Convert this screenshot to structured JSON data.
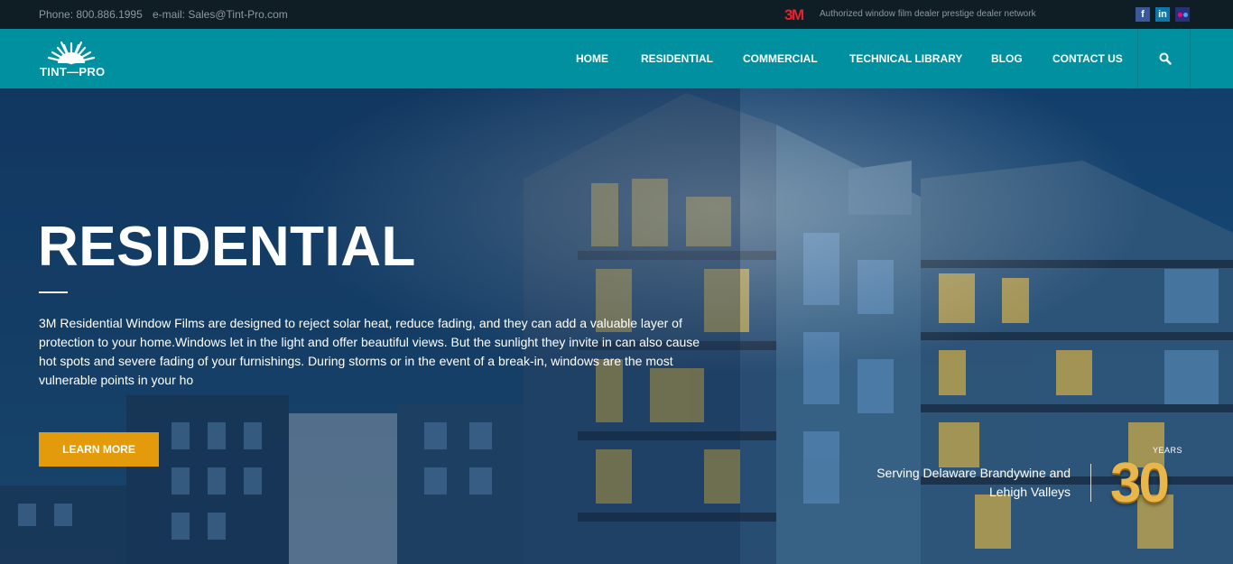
{
  "topbar": {
    "phone": "Phone: 800.886.1995",
    "email": "e-mail: Sales@Tint-Pro.com",
    "brand": "3M",
    "dealer_text": "Authorized window film dealer prestige dealer network",
    "social": [
      {
        "name": "facebook-icon",
        "glyph": "f"
      },
      {
        "name": "linkedin-icon",
        "glyph": "in"
      },
      {
        "name": "flickr-icon",
        "glyph": ""
      }
    ]
  },
  "nav": {
    "logo_text": "TINT—PRO",
    "items": [
      "HOME",
      "RESIDENTIAL",
      "COMMERCIAL",
      "TECHNICAL LIBRARY",
      "BLOG",
      "CONTACT US"
    ],
    "search_icon": "search-icon"
  },
  "hero": {
    "title": "RESIDENTIAL",
    "description": "3M Residential Window Films are designed to reject solar heat, reduce fading, and they can add a valuable layer of protection to your home.Windows let in the light and offer beautiful views. But the sunlight they invite in can also cause hot spots and severe fading of your furnishings. During storms or in the event of a break-in, windows are the most vulnerable points in your ho",
    "button_label": "LEARN MORE",
    "serving_line1": "Serving Delaware Brandywine and",
    "serving_line2": "Lehigh Valleys",
    "years_label": "YEARS",
    "years_number": "30"
  },
  "colors": {
    "topbar_bg": "#0f1e24",
    "nav_bg": "#00909f",
    "button_bg": "#e39a0b",
    "brand_red": "#e4232d",
    "years_gold": "#e8b64a"
  }
}
